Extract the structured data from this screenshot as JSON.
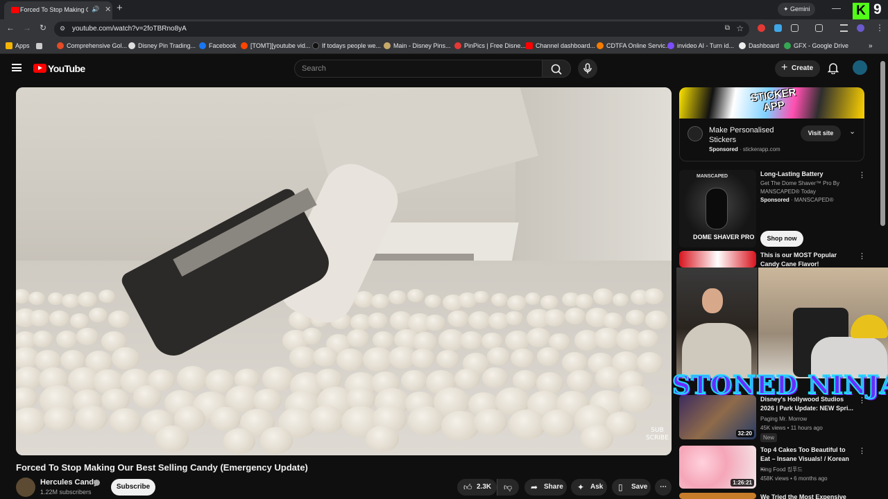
{
  "browser": {
    "tab_title": "Forced To Stop Making Our",
    "url": "youtube.com/watch?v=2foTBRno8yA",
    "gemini_label": "Gemini",
    "kick_letter": "K",
    "kick_count": "9",
    "bookmarks": [
      {
        "label": "Apps",
        "color": "#f4b400"
      },
      {
        "label": "Comprehensive Gol...",
        "color": "#e34c26"
      },
      {
        "label": "Disney Pin Trading...",
        "color": "#dddddd"
      },
      {
        "label": "Facebook",
        "color": "#1877f2"
      },
      {
        "label": "[TOMT][youtube vid...",
        "color": "#ff4500"
      },
      {
        "label": "If todays people we...",
        "color": "#111111"
      },
      {
        "label": "Main - Disney Pins...",
        "color": "#c8a96a"
      },
      {
        "label": "PinPics | Free Disne...",
        "color": "#e53935"
      },
      {
        "label": "Channel dashboard...",
        "color": "#ff0000"
      },
      {
        "label": "CDTFA Online Servic...",
        "color": "#f57c00"
      },
      {
        "label": "invideo AI - Turn id...",
        "color": "#7c4dff"
      },
      {
        "label": "Dashboard",
        "color": "#eeeeee"
      },
      {
        "label": "GFX - Google Drive",
        "color": "#34a853"
      }
    ]
  },
  "header": {
    "logo_text": "YouTube",
    "search_placeholder": "Search",
    "create_label": "Create"
  },
  "video": {
    "title": "Forced To Stop Making Our Best Selling Candy (Emergency Update)",
    "watermark_line1": "SUB",
    "watermark_line2": "SCRIBE",
    "channel_name": "Hercules Candy",
    "subscribers": "1.22M subscribers",
    "subscribe_label": "Subscribe",
    "likes": "2.3K",
    "share_label": "Share",
    "ask_label": "Ask",
    "save_label": "Save"
  },
  "ad": {
    "brand_line1": "STICKER",
    "brand_line2": "APP",
    "headline": "Make Personalised Stickers",
    "sponsored": "Sponsored",
    "domain": "stickerapp.com",
    "visit_label": "Visit site"
  },
  "sidebar_ad": {
    "title": "Long-Lasting Battery",
    "desc": "Get The Dome Shaver™ Pro By MANSCAPED® Today",
    "sponsored": "Sponsored",
    "advertiser": "MANSCAPED®",
    "cta": "Shop now",
    "thumb_brand": "MANSCAPED",
    "thumb_product": "DOME SHAVER PRO"
  },
  "recs": [
    {
      "title": "This is our MOST Popular Candy Cane Flavor!",
      "channel": "",
      "stats": "",
      "duration": "",
      "badge": ""
    },
    {
      "title": "Disney's Hollywood Studios 2026 | Park Update: NEW Spri...",
      "channel": "Paging Mr. Morrow",
      "stats": "45K views • 11 hours ago",
      "duration": "32:20",
      "badge": "New"
    },
    {
      "title": "Top 4 Cakes Too Beautiful to Eat – Insane Visuals! / Korean ...",
      "channel": "King Food 킹푸드",
      "stats": "458K views • 6 months ago",
      "duration": "1:26:21",
      "badge": ""
    },
    {
      "title": "We Tried the Most Expensive",
      "channel": "",
      "stats": "",
      "duration": "",
      "badge": ""
    }
  ],
  "overlay": {
    "text": "STONED NINJA"
  }
}
